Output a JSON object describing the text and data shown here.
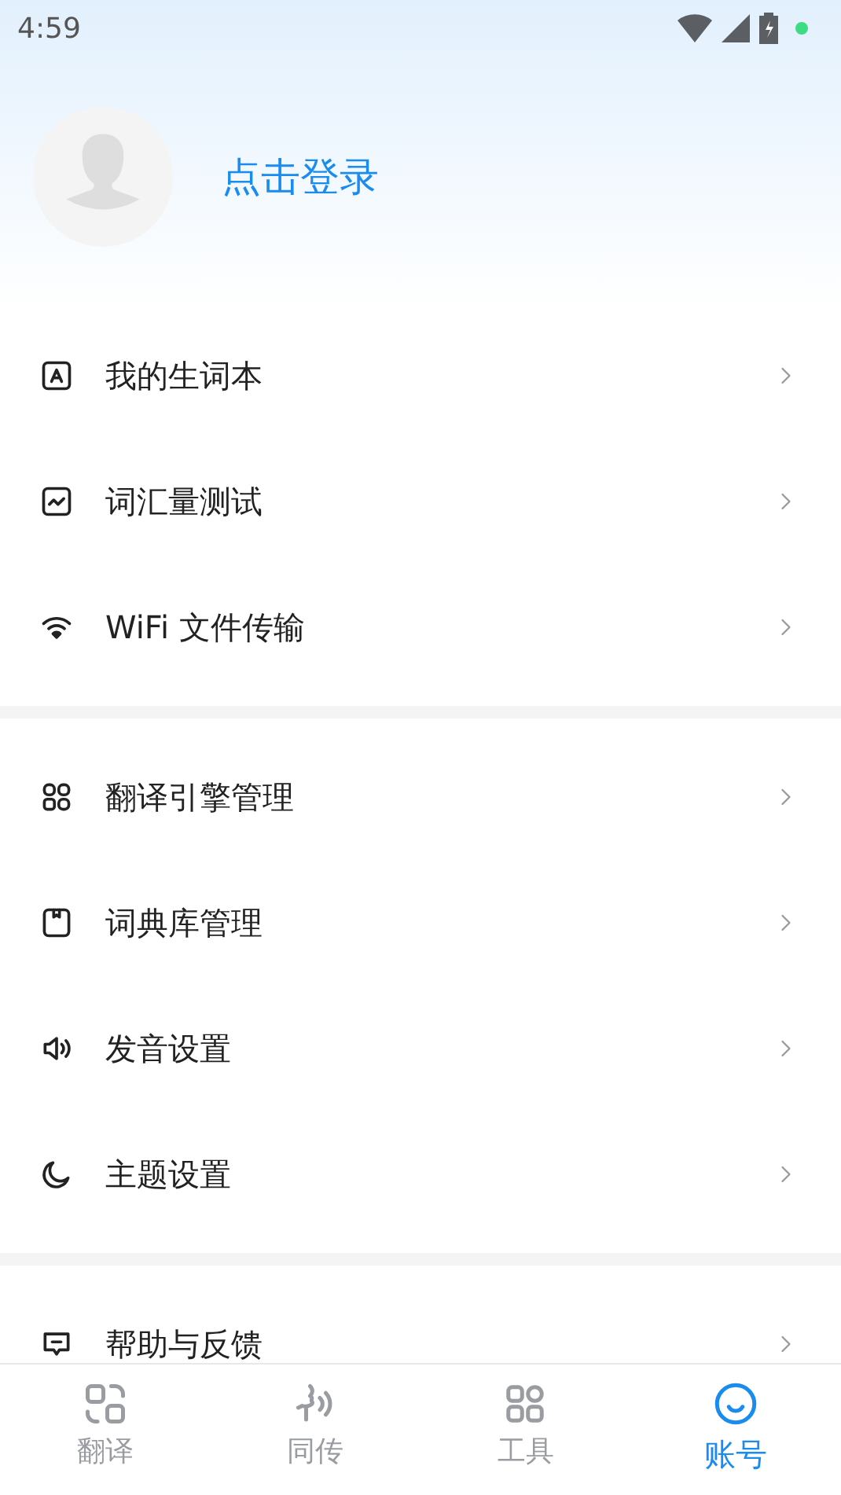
{
  "status_bar": {
    "time": "4:59"
  },
  "profile": {
    "login_label": "点击登录"
  },
  "menu_groups": [
    {
      "items": [
        {
          "label": "我的生词本"
        },
        {
          "label": "词汇量测试"
        },
        {
          "label": "WiFi 文件传输"
        }
      ]
    },
    {
      "items": [
        {
          "label": "翻译引擎管理"
        },
        {
          "label": "词典库管理"
        },
        {
          "label": "发音设置"
        },
        {
          "label": "主题设置"
        }
      ]
    },
    {
      "items": [
        {
          "label": "帮助与反馈"
        }
      ]
    }
  ],
  "bottom_nav": [
    {
      "label": "翻译",
      "selected": false
    },
    {
      "label": "同传",
      "selected": false
    },
    {
      "label": "工具",
      "selected": false
    },
    {
      "label": "账号",
      "selected": true
    }
  ]
}
